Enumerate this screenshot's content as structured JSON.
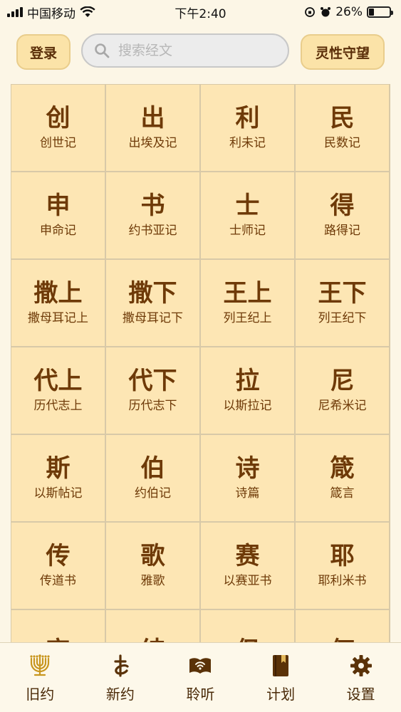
{
  "status_bar": {
    "carrier": "中国移动",
    "time": "下午2:40",
    "battery": "26%",
    "battery_level": 0.26
  },
  "header": {
    "login_label": "登录",
    "search_placeholder": "搜索经文",
    "watch_label": "灵性守望"
  },
  "books": [
    {
      "abbr": "创",
      "name": "创世记"
    },
    {
      "abbr": "出",
      "name": "出埃及记"
    },
    {
      "abbr": "利",
      "name": "利未记"
    },
    {
      "abbr": "民",
      "name": "民数记"
    },
    {
      "abbr": "申",
      "name": "申命记"
    },
    {
      "abbr": "书",
      "name": "约书亚记"
    },
    {
      "abbr": "士",
      "name": "士师记"
    },
    {
      "abbr": "得",
      "name": "路得记"
    },
    {
      "abbr": "撒上",
      "name": "撒母耳记上"
    },
    {
      "abbr": "撒下",
      "name": "撒母耳记下"
    },
    {
      "abbr": "王上",
      "name": "列王纪上"
    },
    {
      "abbr": "王下",
      "name": "列王纪下"
    },
    {
      "abbr": "代上",
      "name": "历代志上"
    },
    {
      "abbr": "代下",
      "name": "历代志下"
    },
    {
      "abbr": "拉",
      "name": "以斯拉记"
    },
    {
      "abbr": "尼",
      "name": "尼希米记"
    },
    {
      "abbr": "斯",
      "name": "以斯帖记"
    },
    {
      "abbr": "伯",
      "name": "约伯记"
    },
    {
      "abbr": "诗",
      "name": "诗篇"
    },
    {
      "abbr": "箴",
      "name": "箴言"
    },
    {
      "abbr": "传",
      "name": "传道书"
    },
    {
      "abbr": "歌",
      "name": "雅歌"
    },
    {
      "abbr": "赛",
      "name": "以赛亚书"
    },
    {
      "abbr": "耶",
      "name": "耶利米书"
    },
    {
      "abbr": "哀",
      "name": ""
    },
    {
      "abbr": "结",
      "name": ""
    },
    {
      "abbr": "但",
      "name": ""
    },
    {
      "abbr": "何",
      "name": ""
    }
  ],
  "tabs": [
    {
      "label": "旧约",
      "icon": "menorah-icon",
      "active": true
    },
    {
      "label": "新约",
      "icon": "cross-icon",
      "active": false
    },
    {
      "label": "聆听",
      "icon": "open-book-audio-icon",
      "active": false
    },
    {
      "label": "计划",
      "icon": "bookmark-book-icon",
      "active": false
    },
    {
      "label": "设置",
      "icon": "gear-icon",
      "active": false
    }
  ],
  "colors": {
    "cell_bg": "#fde6b4",
    "text_brown": "#6e3a08",
    "accent_gold": "#c8961e"
  }
}
